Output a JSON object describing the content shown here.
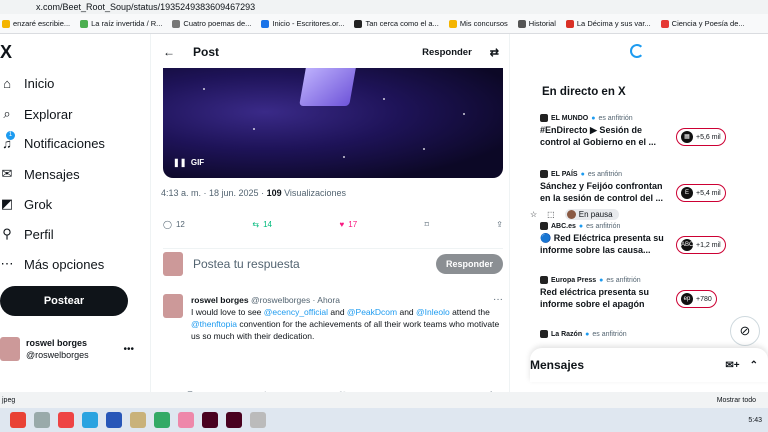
{
  "browser": {
    "url": "x.com/Beet_Root_Soup/status/1935249383609467293",
    "pause_label": "En pausa"
  },
  "bookmarks": [
    {
      "label": "enzaré escribie...",
      "color": "#f4b400"
    },
    {
      "label": "La raíz invertida / R...",
      "color": "#4caf50"
    },
    {
      "label": "Cuatro poemas de...",
      "color": "#777777"
    },
    {
      "label": "Inicio - Escritores.or...",
      "color": "#1a73e8"
    },
    {
      "label": "Tan cerca como el a...",
      "color": "#222222"
    },
    {
      "label": "Mis concursos",
      "color": "#f4b400"
    },
    {
      "label": "Historial",
      "color": "#555555"
    },
    {
      "label": "La Décima y sus var...",
      "color": "#d93025"
    },
    {
      "label": "Ciencia y Poesía de...",
      "color": "#e53935"
    }
  ],
  "sidebar": {
    "logo": "X",
    "items": [
      {
        "label": "Inicio",
        "icon": "home-icon",
        "glyph": "⌂"
      },
      {
        "label": "Explorar",
        "icon": "search-icon",
        "glyph": "⌕"
      },
      {
        "label": "Notificaciones",
        "icon": "bell-icon",
        "glyph": "♫",
        "badge": "1"
      },
      {
        "label": "Mensajes",
        "icon": "mail-icon",
        "glyph": "✉"
      },
      {
        "label": "Grok",
        "icon": "grok-icon",
        "glyph": "◩"
      },
      {
        "label": "Perfil",
        "icon": "profile-icon",
        "glyph": "⚲"
      },
      {
        "label": "Más opciones",
        "icon": "more-icon",
        "glyph": "⋯"
      }
    ],
    "post_button": "Postear",
    "account": {
      "name": "roswel borges",
      "handle": "@roswelborges"
    }
  },
  "post": {
    "header_title": "Post",
    "header_reply_button": "Responder",
    "media_badge": "GIF",
    "timestamp": "4:13 a. m. · 18 jun. 2025 · ",
    "views_count": "109",
    "views_label": " Visualizaciones",
    "actions": {
      "replies": "12",
      "reposts": "14",
      "likes": "17"
    },
    "reply_placeholder": "Postea tu respuesta",
    "reply_button": "Responder"
  },
  "reply_tweet": {
    "name": "roswel borges",
    "meta": "@roswelborges · Ahora",
    "text_parts": [
      {
        "t": "I would love to see ",
        "m": false
      },
      {
        "t": "@ecency_official",
        "m": true
      },
      {
        "t": " and ",
        "m": false
      },
      {
        "t": "@PeakDcom",
        "m": true
      },
      {
        "t": " and ",
        "m": false
      },
      {
        "t": "@Inleolo",
        "m": true
      },
      {
        "t": " attend the ",
        "m": false
      },
      {
        "t": "@thenftopia",
        "m": true
      },
      {
        "t": " convention for the achievements of all their work teams who motivate us so much with their dedication.",
        "m": false
      }
    ]
  },
  "live": {
    "title": "En directo en X",
    "items": [
      {
        "source": "EL MUNDO",
        "role": "es anfitrión",
        "headline": "#EnDirecto ▶ Sesión de control al Gobierno en el ...",
        "count": "+5,6 mil",
        "logo": "▦"
      },
      {
        "source": "EL PAÍS",
        "role": "es anfitrión",
        "headline": "Sánchez y Feijóo confrontan en la sesión de control del ...",
        "count": "+5,4 mil",
        "logo": "E"
      },
      {
        "source": "ABC.es",
        "role": "es anfitrión",
        "headline": "🔵 Red Eléctrica presenta su informe sobre las causa...",
        "count": "+1,2 mil",
        "logo": "ABC"
      },
      {
        "source": "Europa Press",
        "role": "es anfitrión",
        "headline": "Red eléctrica presenta su informe sobre el apagón",
        "count": "+780",
        "logo": "ep"
      },
      {
        "source": "La Razón",
        "role": "es anfitrión",
        "headline": "",
        "count": "",
        "logo": ""
      }
    ]
  },
  "messages": {
    "title": "Mensajes"
  },
  "downloads": {
    "file": "jpeg",
    "show_all": "Mostrar todo"
  },
  "taskbar": {
    "clock": "5:43"
  }
}
